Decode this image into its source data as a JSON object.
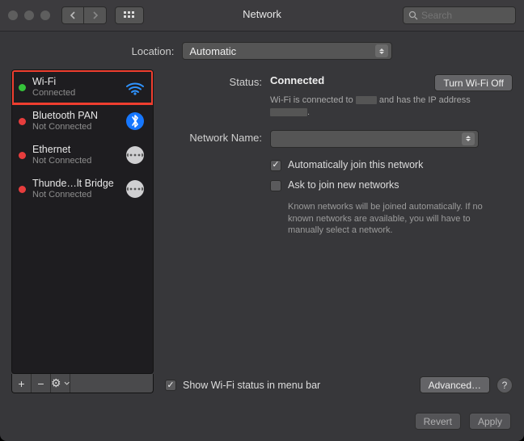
{
  "window": {
    "title": "Network"
  },
  "search": {
    "placeholder": "Search"
  },
  "location": {
    "label": "Location:",
    "value": "Automatic"
  },
  "sidebar": {
    "items": [
      {
        "name": "Wi-Fi",
        "status": "Connected"
      },
      {
        "name": "Bluetooth PAN",
        "status": "Not Connected"
      },
      {
        "name": "Ethernet",
        "status": "Not Connected"
      },
      {
        "name": "Thunde…lt Bridge",
        "status": "Not Connected"
      }
    ],
    "footer": {
      "add": "+",
      "remove": "−",
      "action": "⚙︎"
    }
  },
  "detail": {
    "status_label": "Status:",
    "status_value": "Connected",
    "wifi_off_btn": "Turn Wi-Fi Off",
    "status_desc_prefix": "Wi-Fi is connected to ",
    "status_desc_middle": " and has the IP address ",
    "status_desc_suffix": ".",
    "netname_label": "Network Name:",
    "auto_join": "Automatically join this network",
    "ask_join": "Ask to join new networks",
    "ask_help": "Known networks will be joined automatically. If no known networks are available, you will have to manually select a network.",
    "show_status": "Show Wi-Fi status in menu bar",
    "advanced_btn": "Advanced…",
    "help": "?"
  },
  "footer": {
    "revert": "Revert",
    "apply": "Apply"
  }
}
